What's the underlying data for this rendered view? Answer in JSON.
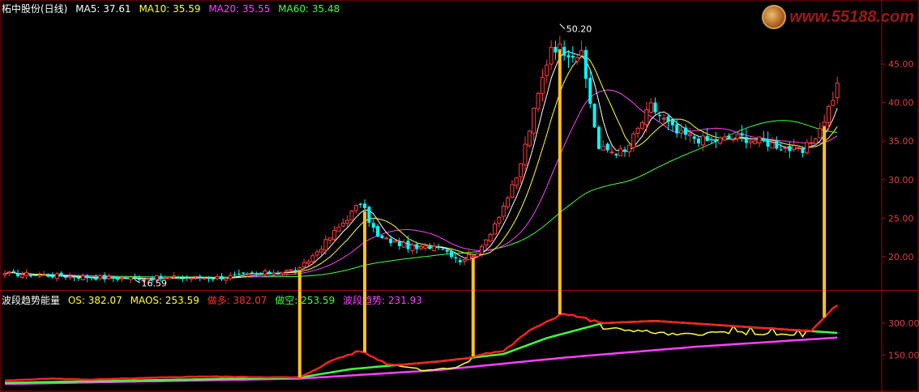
{
  "header_top": {
    "title": "柘中股份(日线)",
    "items": [
      {
        "label": "MA5: 37.61",
        "color": "#ffffff"
      },
      {
        "label": "MA10: 35.59",
        "color": "#ffff40"
      },
      {
        "label": "MA20: 35.55",
        "color": "#ff40ff"
      },
      {
        "label": "MA60: 35.48",
        "color": "#40ff40"
      }
    ]
  },
  "header_bottom": {
    "title": "波段趋势能量",
    "items": [
      {
        "label": "OS: 382.07",
        "color": "#ffff40"
      },
      {
        "label": "MAOS: 253.59",
        "color": "#ffff40"
      },
      {
        "label": "做多: 382.07",
        "color": "#ff3030"
      },
      {
        "label": "做空: 253.59",
        "color": "#40ff40"
      },
      {
        "label": "波段趋势: 231.93",
        "color": "#ff40ff"
      }
    ]
  },
  "watermark": {
    "text": "www.55188.com"
  },
  "colors": {
    "background": "#000000",
    "frame": "#b00000",
    "up": "#ff3c3c",
    "down": "#00ffff",
    "ma5": "#ffffff",
    "ma10": "#ffff40",
    "ma20": "#ff40ff",
    "ma60": "#40ff40",
    "os": "#ffff40",
    "long": "#ff2020",
    "short": "#40ff40",
    "trend": "#ff40ff",
    "signal": "#ffc020"
  },
  "chart_data": [
    {
      "type": "candlestick",
      "panel": "price",
      "ylim": [
        16,
        51
      ],
      "yticks": [
        "20.00",
        "25.00",
        "30.00",
        "35.00",
        "40.00",
        "45.00"
      ],
      "annotations": [
        {
          "label": "50.20",
          "value": 50.2
        },
        {
          "label": "16.59",
          "value": 16.59
        }
      ],
      "key_closes": [
        {
          "bar": 0,
          "close": 17.8
        },
        {
          "bar": 25,
          "close": 17.2
        },
        {
          "bar": 50,
          "close": 17.3
        },
        {
          "bar": 68,
          "close": 18.3
        },
        {
          "bar": 75,
          "close": 22.5
        },
        {
          "bar": 82,
          "close": 27.0
        },
        {
          "bar": 86,
          "close": 22.5
        },
        {
          "bar": 95,
          "close": 21.0
        },
        {
          "bar": 100,
          "close": 21.5
        },
        {
          "bar": 105,
          "close": 19.5
        },
        {
          "bar": 110,
          "close": 21.0
        },
        {
          "bar": 118,
          "close": 30.0
        },
        {
          "bar": 126,
          "close": 47.5
        },
        {
          "bar": 133,
          "close": 46.0
        },
        {
          "bar": 137,
          "close": 34.0
        },
        {
          "bar": 143,
          "close": 33.5
        },
        {
          "bar": 149,
          "close": 39.5
        },
        {
          "bar": 155,
          "close": 36.0
        },
        {
          "bar": 162,
          "close": 35.0
        },
        {
          "bar": 170,
          "close": 35.5
        },
        {
          "bar": 178,
          "close": 34.5
        },
        {
          "bar": 184,
          "close": 33.5
        },
        {
          "bar": 188,
          "close": 36.5
        },
        {
          "bar": 192,
          "close": 42.0
        }
      ]
    },
    {
      "type": "line",
      "panel": "indicator",
      "ylim": [
        0,
        440
      ],
      "yticks": [
        "150.00",
        "300.00"
      ],
      "series": [
        {
          "name": "做多",
          "key_values": [
            {
              "bar": 0,
              "value": 30
            },
            {
              "bar": 10,
              "value": 40
            },
            {
              "bar": 20,
              "value": 35
            },
            {
              "bar": 45,
              "value": 50
            },
            {
              "bar": 68,
              "value": 45
            },
            {
              "bar": 76,
              "value": 130
            },
            {
              "bar": 82,
              "value": 170
            },
            {
              "bar": 88,
              "value": 110
            },
            {
              "bar": 96,
              "value": 85
            },
            {
              "bar": 104,
              "value": 100
            },
            {
              "bar": 109,
              "value": 150
            },
            {
              "bar": 115,
              "value": 170
            },
            {
              "bar": 123,
              "value": 290
            },
            {
              "bar": 129,
              "value": 350
            },
            {
              "bar": 137,
              "value": 300
            },
            {
              "bar": 145,
              "value": 290
            },
            {
              "bar": 155,
              "value": 265
            },
            {
              "bar": 166,
              "value": 280
            },
            {
              "bar": 176,
              "value": 270
            },
            {
              "bar": 186,
              "value": 260
            },
            {
              "bar": 192,
              "value": 382
            }
          ]
        },
        {
          "name": "做空",
          "key_values": [
            {
              "bar": 0,
              "value": 20
            },
            {
              "bar": 40,
              "value": 35
            },
            {
              "bar": 68,
              "value": 45
            },
            {
              "bar": 80,
              "value": 85
            },
            {
              "bar": 100,
              "value": 120
            },
            {
              "bar": 115,
              "value": 155
            },
            {
              "bar": 125,
              "value": 230
            },
            {
              "bar": 138,
              "value": 300
            },
            {
              "bar": 150,
              "value": 310
            },
            {
              "bar": 165,
              "value": 290
            },
            {
              "bar": 180,
              "value": 270
            },
            {
              "bar": 192,
              "value": 254
            }
          ]
        },
        {
          "name": "波段趋势",
          "key_values": [
            {
              "bar": 0,
              "value": 15
            },
            {
              "bar": 68,
              "value": 40
            },
            {
              "bar": 100,
              "value": 80
            },
            {
              "bar": 130,
              "value": 140
            },
            {
              "bar": 160,
              "value": 190
            },
            {
              "bar": 192,
              "value": 232
            }
          ]
        }
      ],
      "signals": [
        {
          "bar": 68
        },
        {
          "bar": 83
        },
        {
          "bar": 108
        },
        {
          "bar": 128
        },
        {
          "bar": 189
        }
      ]
    }
  ]
}
